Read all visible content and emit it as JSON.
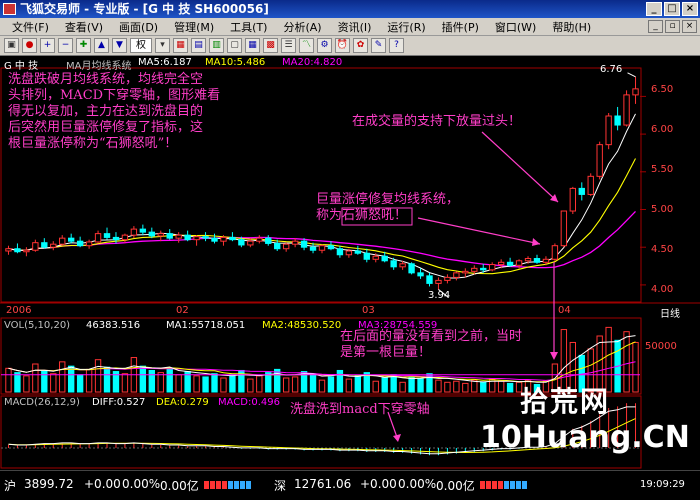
{
  "window": {
    "title": "飞狐交易师 - 专业版 - [G 中  技 SH600056]"
  },
  "menu": [
    "文件(F)",
    "查看(V)",
    "画面(D)",
    "管理(M)",
    "工具(T)",
    "分析(A)",
    "资讯(I)",
    "运行(R)",
    "插件(P)",
    "窗口(W)",
    "帮助(H)"
  ],
  "toolbar": {
    "quan_label": "权"
  },
  "price_panel": {
    "stock_label": "G 中  技",
    "indicator_name": "MA月均线系统",
    "ma5": "MA5:6.187",
    "ma10": "MA10:5.486",
    "ma20": "MA20:4.820",
    "y_ticks": [
      "6.50",
      "6.00",
      "5.50",
      "5.00",
      "4.50",
      "4.00"
    ],
    "high_label": "6.76",
    "low_label": "3.94",
    "x_labels": [
      "2006",
      "02",
      "03",
      "04"
    ],
    "period": "日线"
  },
  "volume_panel": {
    "header": "VOL(5,10,20)",
    "vol": "46383.516",
    "ma1": "MA1:55718.051",
    "ma2": "MA2:48530.520",
    "ma3": "MA3:28754.559",
    "y_tick": "50000"
  },
  "macd_panel": {
    "header": "MACD(26,12,9)",
    "diff": "DIFF:0.527",
    "dea": "DEA:0.279",
    "macd": "MACD:0.496"
  },
  "annotations": {
    "left_note": [
      "洗盘跌破月均线系统，均线完全空",
      "头排列，MACD下穿零轴，图形难看",
      "得无以复加，主力在达到洗盘目的",
      "后突然用巨量涨停修复了指标，这",
      "根巨量涨停称为“石狮怒吼”！"
    ],
    "vol_support": "在成交量的支持下放量过头！",
    "giant_limit": [
      "巨量涨停修复均线系统，",
      "称为石狮怒吼！"
    ],
    "first_giant": [
      "在后面的量没有看到之前，当时",
      "是第一根巨量！"
    ],
    "macd_note": "洗盘洗到macd下穿零轴"
  },
  "status": {
    "sh_label": "沪",
    "sh_value": "3899.72",
    "sh_change": "+0.00",
    "sh_pct": "0.00%",
    "sh_amount": "0.00亿",
    "sz_label": "深",
    "sz_value": "12761.06",
    "sz_change": "+0.00",
    "sz_pct": "0.00%",
    "sz_amount": "0.00亿",
    "time": "19:09:29"
  },
  "watermark": {
    "line1": "拾荒网",
    "line2": "10Huang.CN"
  },
  "colors": {
    "ma5": "#ffffff",
    "ma10": "#ffff00",
    "ma20": "#ff00ff",
    "up": "#ff3333",
    "down": "#00ffff",
    "annotation": "#ff3ec8"
  },
  "chart_data": {
    "type": "candlestick",
    "price_range": [
      3.8,
      6.85
    ],
    "candles": [
      [
        4.45,
        4.52,
        4.4,
        4.48
      ],
      [
        4.48,
        4.55,
        4.42,
        4.44
      ],
      [
        4.44,
        4.5,
        4.38,
        4.46
      ],
      [
        4.46,
        4.6,
        4.44,
        4.56
      ],
      [
        4.56,
        4.62,
        4.48,
        4.5
      ],
      [
        4.5,
        4.58,
        4.46,
        4.54
      ],
      [
        4.54,
        4.66,
        4.52,
        4.62
      ],
      [
        4.62,
        4.68,
        4.55,
        4.58
      ],
      [
        4.58,
        4.64,
        4.5,
        4.52
      ],
      [
        4.52,
        4.6,
        4.48,
        4.57
      ],
      [
        4.57,
        4.72,
        4.55,
        4.68
      ],
      [
        4.68,
        4.76,
        4.6,
        4.63
      ],
      [
        4.63,
        4.7,
        4.55,
        4.6
      ],
      [
        4.6,
        4.68,
        4.56,
        4.66
      ],
      [
        4.66,
        4.78,
        4.62,
        4.74
      ],
      [
        4.74,
        4.8,
        4.66,
        4.7
      ],
      [
        4.7,
        4.76,
        4.62,
        4.65
      ],
      [
        4.65,
        4.72,
        4.58,
        4.68
      ],
      [
        4.68,
        4.74,
        4.6,
        4.62
      ],
      [
        4.62,
        4.7,
        4.56,
        4.66
      ],
      [
        4.66,
        4.72,
        4.58,
        4.6
      ],
      [
        4.6,
        4.66,
        4.52,
        4.64
      ],
      [
        4.64,
        4.7,
        4.58,
        4.62
      ],
      [
        4.62,
        4.68,
        4.55,
        4.58
      ],
      [
        4.58,
        4.66,
        4.52,
        4.63
      ],
      [
        4.63,
        4.7,
        4.58,
        4.6
      ],
      [
        4.6,
        4.64,
        4.5,
        4.53
      ],
      [
        4.53,
        4.62,
        4.5,
        4.58
      ],
      [
        4.58,
        4.66,
        4.55,
        4.62
      ],
      [
        4.62,
        4.66,
        4.52,
        4.55
      ],
      [
        4.55,
        4.6,
        4.45,
        4.48
      ],
      [
        4.48,
        4.56,
        4.44,
        4.54
      ],
      [
        4.54,
        4.62,
        4.5,
        4.58
      ],
      [
        4.58,
        4.62,
        4.46,
        4.5
      ],
      [
        4.5,
        4.56,
        4.42,
        4.46
      ],
      [
        4.46,
        4.54,
        4.42,
        4.52
      ],
      [
        4.52,
        4.58,
        4.46,
        4.48
      ],
      [
        4.48,
        4.52,
        4.36,
        4.4
      ],
      [
        4.4,
        4.48,
        4.36,
        4.45
      ],
      [
        4.45,
        4.52,
        4.4,
        4.42
      ],
      [
        4.42,
        4.48,
        4.3,
        4.34
      ],
      [
        4.34,
        4.42,
        4.3,
        4.38
      ],
      [
        4.38,
        4.44,
        4.3,
        4.32
      ],
      [
        4.32,
        4.36,
        4.2,
        4.24
      ],
      [
        4.24,
        4.32,
        4.2,
        4.28
      ],
      [
        4.28,
        4.3,
        4.14,
        4.16
      ],
      [
        4.16,
        4.22,
        4.08,
        4.12
      ],
      [
        4.12,
        4.16,
        3.98,
        4.02
      ],
      [
        4.02,
        4.1,
        3.94,
        4.06
      ],
      [
        4.06,
        4.14,
        4.02,
        4.1
      ],
      [
        4.1,
        4.18,
        4.06,
        4.16
      ],
      [
        4.16,
        4.22,
        4.1,
        4.18
      ],
      [
        4.18,
        4.26,
        4.14,
        4.22
      ],
      [
        4.22,
        4.28,
        4.16,
        4.2
      ],
      [
        4.2,
        4.3,
        4.18,
        4.27
      ],
      [
        4.27,
        4.34,
        4.22,
        4.3
      ],
      [
        4.3,
        4.36,
        4.24,
        4.26
      ],
      [
        4.26,
        4.34,
        4.22,
        4.32
      ],
      [
        4.32,
        4.38,
        4.28,
        4.35
      ],
      [
        4.35,
        4.4,
        4.28,
        4.3
      ],
      [
        4.3,
        4.38,
        4.26,
        4.34
      ],
      [
        4.34,
        4.55,
        4.32,
        4.52
      ],
      [
        4.52,
        4.98,
        4.5,
        4.98
      ],
      [
        4.98,
        5.3,
        4.94,
        5.28
      ],
      [
        5.28,
        5.36,
        5.12,
        5.2
      ],
      [
        5.2,
        5.48,
        5.18,
        5.44
      ],
      [
        5.44,
        5.9,
        5.4,
        5.86
      ],
      [
        5.86,
        6.28,
        5.8,
        6.24
      ],
      [
        6.24,
        6.36,
        6.05,
        6.12
      ],
      [
        6.12,
        6.58,
        6.1,
        6.52
      ],
      [
        6.52,
        6.76,
        6.4,
        6.6
      ]
    ],
    "volumes": [
      [
        22000,
        1
      ],
      [
        18000,
        0
      ],
      [
        15000,
        1
      ],
      [
        26000,
        1
      ],
      [
        20000,
        0
      ],
      [
        17000,
        1
      ],
      [
        28000,
        1
      ],
      [
        24000,
        0
      ],
      [
        16000,
        0
      ],
      [
        21000,
        1
      ],
      [
        30000,
        1
      ],
      [
        23000,
        0
      ],
      [
        19000,
        0
      ],
      [
        17000,
        1
      ],
      [
        32000,
        1
      ],
      [
        24000,
        0
      ],
      [
        20000,
        0
      ],
      [
        18000,
        1
      ],
      [
        22000,
        0
      ],
      [
        16000,
        1
      ],
      [
        19000,
        0
      ],
      [
        15000,
        1
      ],
      [
        14000,
        0
      ],
      [
        17000,
        0
      ],
      [
        13000,
        1
      ],
      [
        16000,
        0
      ],
      [
        20000,
        0
      ],
      [
        12000,
        1
      ],
      [
        15000,
        1
      ],
      [
        18000,
        0
      ],
      [
        21000,
        0
      ],
      [
        13000,
        1
      ],
      [
        14000,
        1
      ],
      [
        19000,
        0
      ],
      [
        17000,
        0
      ],
      [
        11000,
        1
      ],
      [
        14000,
        0
      ],
      [
        20000,
        0
      ],
      [
        12000,
        1
      ],
      [
        15000,
        0
      ],
      [
        18000,
        0
      ],
      [
        10000,
        1
      ],
      [
        13000,
        0
      ],
      [
        16000,
        0
      ],
      [
        9000,
        1
      ],
      [
        14000,
        0
      ],
      [
        12000,
        0
      ],
      [
        17000,
        0
      ],
      [
        11000,
        1
      ],
      [
        9000,
        1
      ],
      [
        10000,
        1
      ],
      [
        8000,
        1
      ],
      [
        11000,
        1
      ],
      [
        9000,
        0
      ],
      [
        12000,
        1
      ],
      [
        10000,
        1
      ],
      [
        8000,
        0
      ],
      [
        9000,
        1
      ],
      [
        11000,
        1
      ],
      [
        7000,
        0
      ],
      [
        10000,
        1
      ],
      [
        26000,
        1
      ],
      [
        58000,
        1
      ],
      [
        46000,
        1
      ],
      [
        34000,
        0
      ],
      [
        40000,
        1
      ],
      [
        52000,
        1
      ],
      [
        60000,
        1
      ],
      [
        48000,
        0
      ],
      [
        56000,
        1
      ],
      [
        46000,
        1
      ]
    ],
    "macd_hist": [
      0.04,
      0.03,
      0.03,
      0.04,
      0.05,
      0.05,
      0.06,
      0.06,
      0.05,
      0.05,
      0.06,
      0.06,
      0.05,
      0.05,
      0.06,
      0.05,
      0.04,
      0.04,
      0.03,
      0.03,
      0.02,
      0.02,
      0.02,
      0.01,
      0.01,
      0.0,
      -0.01,
      -0.01,
      -0.01,
      -0.02,
      -0.02,
      -0.02,
      -0.02,
      -0.03,
      -0.03,
      -0.03,
      -0.03,
      -0.04,
      -0.04,
      -0.04,
      -0.05,
      -0.05,
      -0.05,
      -0.06,
      -0.06,
      -0.07,
      -0.08,
      -0.09,
      -0.09,
      -0.08,
      -0.07,
      -0.06,
      -0.05,
      -0.04,
      -0.03,
      -0.02,
      -0.02,
      -0.01,
      0.0,
      0.0,
      0.01,
      0.05,
      0.15,
      0.24,
      0.28,
      0.34,
      0.42,
      0.5,
      0.52,
      0.56,
      0.56
    ]
  }
}
